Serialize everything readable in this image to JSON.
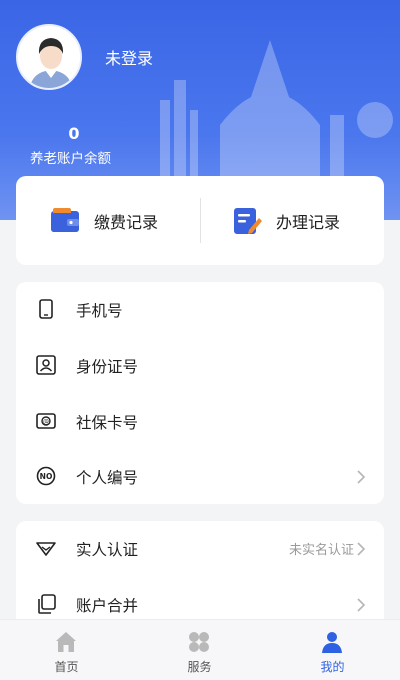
{
  "header": {
    "login_status": "未登录",
    "balance_value": "0",
    "balance_label": "养老账户余额"
  },
  "quick_actions": [
    {
      "label": "缴费记录",
      "icon": "wallet-icon"
    },
    {
      "label": "办理记录",
      "icon": "edit-record-icon"
    }
  ],
  "info_rows": [
    {
      "label": "手机号",
      "icon": "phone-icon"
    },
    {
      "label": "身份证号",
      "icon": "id-card-icon"
    },
    {
      "label": "社保卡号",
      "icon": "social-security-card-icon"
    },
    {
      "label": "个人编号",
      "icon": "number-badge-icon"
    }
  ],
  "auth_rows": [
    {
      "label": "实人认证",
      "value": "未实名认证",
      "icon": "verify-icon"
    },
    {
      "label": "账户合并",
      "value": "",
      "icon": "merge-account-icon"
    }
  ],
  "tabs": [
    {
      "label": "首页",
      "icon": "home-icon"
    },
    {
      "label": "服务",
      "icon": "service-grid-icon"
    },
    {
      "label": "我的",
      "icon": "user-icon"
    }
  ],
  "colors": {
    "primary": "#2f61e3",
    "accent_orange": "#f08a2e"
  }
}
